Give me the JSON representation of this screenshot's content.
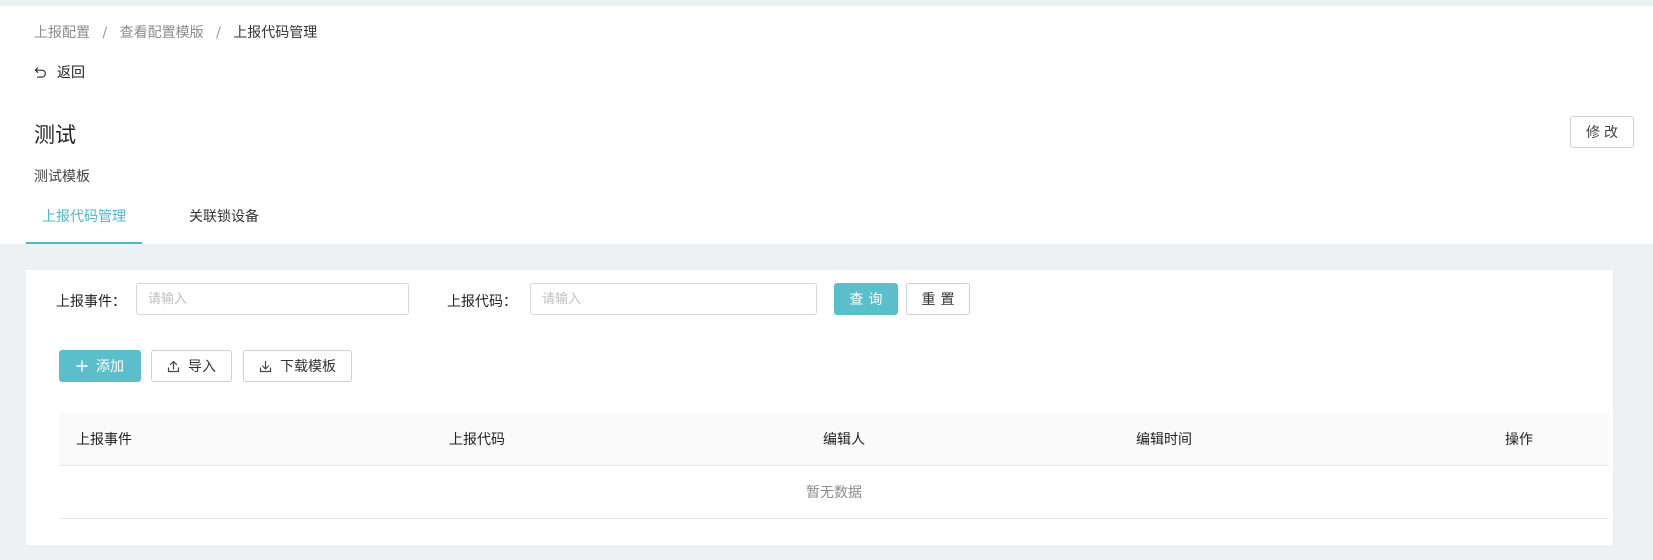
{
  "breadcrumb": {
    "items": [
      "上报配置",
      "查看配置模版",
      "上报代码管理"
    ],
    "separator": "/"
  },
  "back": {
    "label": "返回",
    "icon": "undo-arrow-icon"
  },
  "page": {
    "title": "测试",
    "description": "测试模板",
    "edit_label": "修改"
  },
  "tabs": [
    {
      "label": "上报代码管理",
      "active": true
    },
    {
      "label": "关联锁设备",
      "active": false
    }
  ],
  "filters": {
    "event_label": "上报事件：",
    "event_placeholder": "请输入",
    "event_value": "",
    "code_label": "上报代码：",
    "code_placeholder": "请输入",
    "code_value": "",
    "query_label": "查询",
    "reset_label": "重置"
  },
  "toolbar": {
    "add_label": "添加",
    "add_icon": "plus-icon",
    "import_label": "导入",
    "import_icon": "upload-icon",
    "download_label": "下载模板",
    "download_icon": "download-icon"
  },
  "table": {
    "columns": [
      "上报事件",
      "上报代码",
      "编辑人",
      "编辑时间",
      "操作"
    ],
    "rows": [],
    "empty_text": "暂无数据"
  },
  "colors": {
    "accent": "#5bbfcb",
    "tab_active": "#4fb8c7",
    "page_bg": "#eef1f3"
  }
}
